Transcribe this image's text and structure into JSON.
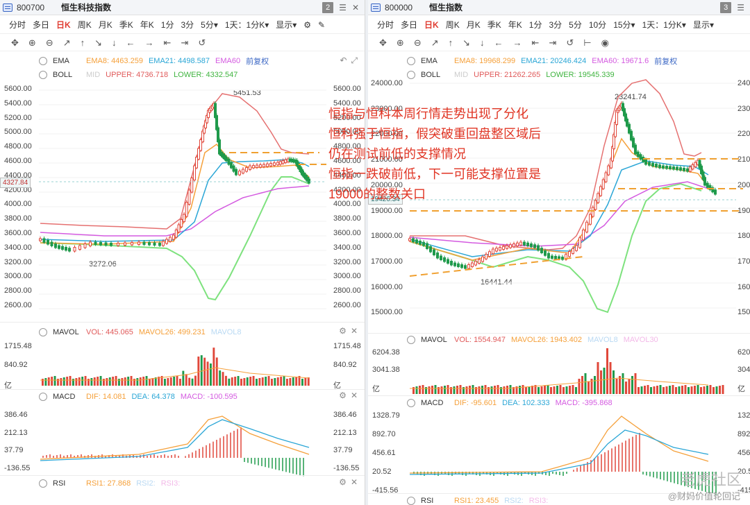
{
  "left": {
    "code": "800700",
    "name": "恒生科技指数",
    "badge": "2",
    "periods": [
      "分时",
      "多日",
      "日K",
      "周K",
      "月K",
      "季K",
      "年K",
      "1分",
      "3分",
      "5分▾",
      "1天：1分K▾",
      "显示▾"
    ],
    "ema": {
      "label": "EMA",
      "ema8": "EMA8: 4463.259",
      "ema21": "EMA21: 4498.587",
      "ema60": "EMA60",
      "fq": "前复权"
    },
    "boll": {
      "label": "BOLL",
      "mid": "MID",
      "upper": "UPPER: 4736.718",
      "lower": "LOWER: 4332.547"
    },
    "price_axis": [
      "5600.00",
      "5400.00",
      "5200.00",
      "5000.00",
      "4800.00",
      "4600.00",
      "4400.00",
      "4200.00",
      "4000.00",
      "3800.00",
      "3600.00",
      "3400.00",
      "3200.00",
      "3000.00",
      "2800.00",
      "2600.00"
    ],
    "price_tag": "4327.84",
    "high_label": "5451.53",
    "low_label": "3272.06",
    "mavol": {
      "label": "MAVOL",
      "vol": "VOL: 445.065",
      "mavol26": "MAVOL26: 499.231",
      "mavol8": "MAVOL8"
    },
    "vol_axis": [
      "1715.48",
      "840.92",
      "亿"
    ],
    "macd": {
      "label": "MACD",
      "dif": "DIF: 14.081",
      "dea": "DEA: 64.378",
      "macd": "MACD: -100.595"
    },
    "macd_axis": [
      "386.46",
      "212.13",
      "37.79",
      "-136.55"
    ],
    "rsi": {
      "label": "RSI",
      "rsi1": "RSI1: 27.868",
      "rsi2": "RSI2:",
      "rsi3": "RSI3:"
    }
  },
  "right": {
    "code": "800000",
    "name": "恒生指数",
    "badge": "3",
    "periods": [
      "分时",
      "多日",
      "日K",
      "周K",
      "月K",
      "季K",
      "年K",
      "1分",
      "3分",
      "5分",
      "10分",
      "15分▾",
      "1天：1分K▾",
      "显示▾"
    ],
    "ema": {
      "label": "EMA",
      "ema8": "EMA8: 19968.299",
      "ema21": "EMA21: 20246.424",
      "ema60": "EMA60: 19671.6",
      "fq": "前复权"
    },
    "boll": {
      "label": "BOLL",
      "mid": "MID",
      "upper": "UPPER: 21262.265",
      "lower": "LOWER: 19545.339"
    },
    "price_axis": [
      "24000.00",
      "23000.00",
      "22000.00",
      "21000.00",
      "20000.00",
      "19000.00",
      "18000.00",
      "17000.00",
      "16000.00",
      "15000.00"
    ],
    "price_tag": "19426.34",
    "high_label": "23241.74",
    "low_label": "16441.44",
    "mavol": {
      "label": "MAVOL",
      "vol": "VOL: 1554.947",
      "mavol26": "MAVOL26: 1943.402",
      "mavol8": "MAVOL8",
      "mavol30": "MAVOL30"
    },
    "vol_axis": [
      "6204.38",
      "3041.38",
      "亿"
    ],
    "macd": {
      "label": "MACD",
      "dif": "DIF: -95.601",
      "dea": "DEA: 102.333",
      "macd": "MACD: -395.868"
    },
    "macd_axis": [
      "1328.79",
      "892.70",
      "456.61",
      "20.52",
      "-415.56"
    ],
    "rsi": {
      "label": "RSI",
      "rsi1": "RSI1: 23.455",
      "rsi2": "RSI2:",
      "rsi3": "RSI3:"
    }
  },
  "annotation": [
    "恒指与恒科本周行情走势出现了分化",
    "恒科强于恒指，假突破重回盘整区域后",
    "仍在测试前低的支撑情况",
    "恒指一跌破前低，下一可能支撑位置是",
    "19000的整数关口"
  ],
  "watermark": "老虎社区",
  "watermark2": "@财妈价值轮回记",
  "colors": {
    "up": "#e0473a",
    "down": "#1f9a4b",
    "ema8": "#f5a03a",
    "ema21": "#2aa6d6",
    "ema60": "#d45ae0",
    "upper": "#e57070",
    "lower": "#7ee27e",
    "annotation": "#e03322",
    "support": "#f0a030"
  }
}
